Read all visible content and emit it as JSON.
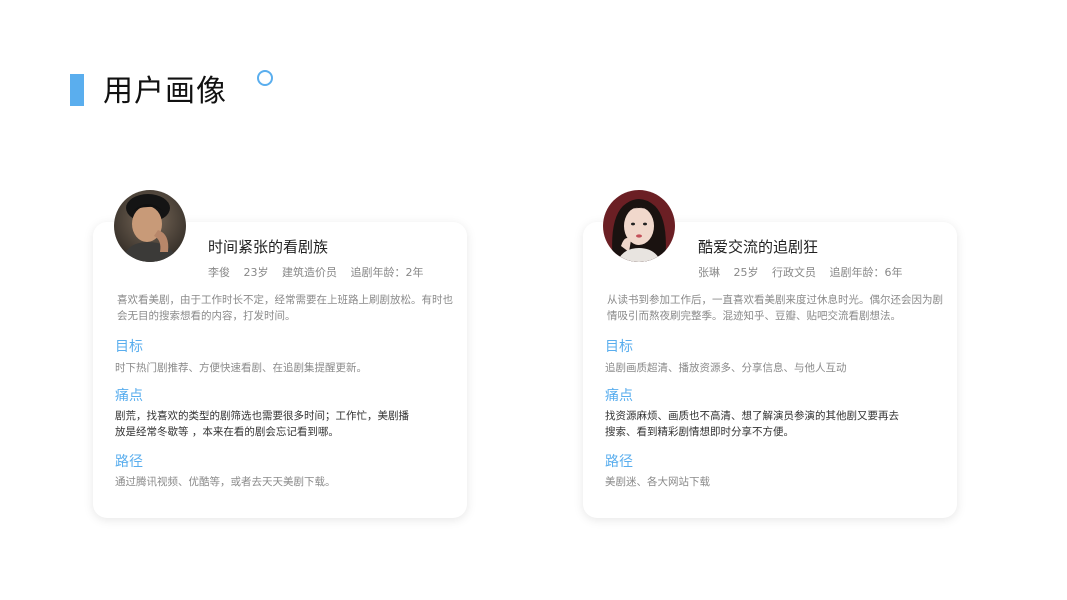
{
  "header": {
    "title": "用户画像",
    "accent_color": "#5aaeee"
  },
  "personas": [
    {
      "title": "时间紧张的看剧族",
      "name": "李俊",
      "age": "23岁",
      "job": "建筑造价员",
      "years": "追剧年龄：2年",
      "intro": "喜欢看美剧，由于工作时长不定，经常需要在上班路上刷剧放松。有时也会无目的搜索想看的内容，打发时间。",
      "goal_label": "目标",
      "goal": "时下热门剧推荐、方便快速看剧、在追剧集提醒更新。",
      "pain_label": "痛点",
      "pain_line1": "剧荒，找喜欢的类型的剧筛选也需要很多时间；工作忙，美剧播",
      "pain_line2": "放是经常冬歇等 ，本来在看的剧会忘记看到哪。",
      "path_label": "路径",
      "path": "通过腾讯视频、优酷等，或者去天天美剧下载。"
    },
    {
      "title": "酷爱交流的追剧狂",
      "name": "张琳",
      "age": "25岁",
      "job": "行政文员",
      "years": "追剧年龄：6年",
      "intro": "从读书到参加工作后，一直喜欢看美剧来度过休息时光。偶尔还会因为剧情吸引而熬夜刷完整季。混迹知乎、豆瓣、贴吧交流看剧想法。",
      "goal_label": "目标",
      "goal": "追剧画质超清、播放资源多、分享信息、与他人互动",
      "pain_label": "痛点",
      "pain_line1": "找资源麻烦、画质也不高清、想了解演员参演的其他剧又要再去",
      "pain_line2": "搜索、看到精彩剧情想即时分享不方便。",
      "path_label": "路径",
      "path": "美剧迷、各大网站下载"
    }
  ]
}
